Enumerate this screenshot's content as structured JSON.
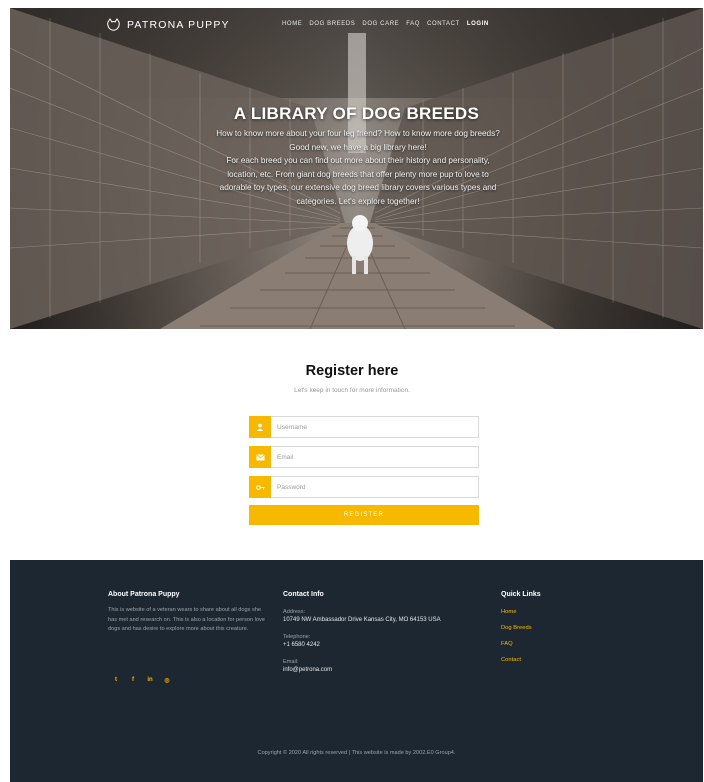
{
  "nav": {
    "brand": "PATRONA PUPPY",
    "items": [
      "HOME",
      "DOG BREEDS",
      "DOG CARE",
      "FAQ",
      "CONTACT",
      "LOGIN"
    ]
  },
  "hero": {
    "title": "A LIBRARY OF DOG BREEDS",
    "line1": "How to know more about your four leg friend? How to know more dog breeds?",
    "line2": "Good new, we have a big library here!",
    "line3": "For each breed you can find out more about their history and personality,",
    "line4": "location, etc. From giant dog breeds that offer plenty more pup to love to",
    "line5": "adorable toy types, our extensive dog breed library covers various types and",
    "line6": "categories. Let's explore together!"
  },
  "register": {
    "title": "Register here",
    "subtitle": "Let's keep in touch for more information.",
    "username_placeholder": "Username",
    "email_placeholder": "Email",
    "password_placeholder": "Password",
    "button": "REGISTER"
  },
  "footer": {
    "about_title": "About Patrona Puppy",
    "about_text": "This is website of a veteran wears to share about all dogs she has met and research on. This is also a location for person love dogs and has desire to explore more about this creature.",
    "contact_title": "Contact Info",
    "address_label": "Address:",
    "address": "10749 NW Ambassador Drive Kansas City, MO 64153 USA",
    "phone_label": "Telephone:",
    "phone": "+1 6580 4242",
    "email_label": "Email:",
    "email": "info@petrona.com",
    "links_title": "Quick Links",
    "links": [
      "Home",
      "Dog Breeds",
      "FAQ",
      "Contact"
    ],
    "social": [
      "twitter",
      "facebook",
      "linkedin",
      "instagram"
    ],
    "copyright": "Copyright © 2020 All rights reserved | This website is made by 2002.E0 Group4."
  },
  "colors": {
    "accent": "#f6b900",
    "footer_bg": "#1d2731"
  }
}
